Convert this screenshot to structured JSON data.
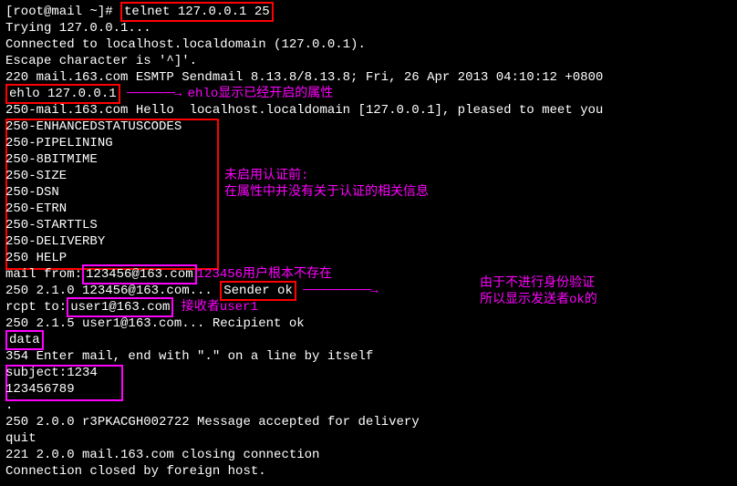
{
  "terminal": {
    "prompt": "[root@mail ~]# ",
    "cmd_telnet": "telnet 127.0.0.1 25",
    "l_trying": "Trying 127.0.0.1...",
    "l_connected": "Connected to localhost.localdomain (127.0.0.1).",
    "l_escape": "Escape character is '^]'.",
    "l_220": "220 mail.163.com ESMTP Sendmail 8.13.8/8.13.8; Fri, 26 Apr 2013 04:10:12 +0800",
    "cmd_ehlo": "ehlo 127.0.0.1",
    "ann_ehlo": "ehlo显示已经开启的属性",
    "l_250hello": "250-mail.163.com Hello  localhost.localdomain [127.0.0.1], pleased to meet you",
    "caps": [
      "250-ENHANCEDSTATUSCODES",
      "250-PIPELINING",
      "250-8BITMIME",
      "250-SIZE",
      "250-DSN",
      "250-ETRN",
      "250-STARTTLS",
      "250-DELIVERBY",
      "250 HELP"
    ],
    "ann_noauth1": "未启用认证前:",
    "ann_noauth2": "在属性中并没有关于认证的相关信息",
    "mailfrom_pre": "mail from:",
    "mailfrom_addr": "123456@163.com",
    "ann_nouser": "123456用户根本不存在",
    "l_senderok_pre": "250 2.1.0 123456@163.com... ",
    "l_senderok_box": "Sender ok",
    "ann_whyok1": "由于不进行身份验证",
    "ann_whyok2": "所以显示发送者ok的",
    "rcpt_pre": "rcpt to:",
    "rcpt_addr": "user1@163.com",
    "ann_recipient": "接收者user1",
    "l_rcptok": "250 2.1.5 user1@163.com... Recipient ok",
    "cmd_data": "data",
    "l_354": "354 Enter mail, end with \".\" on a line by itself",
    "body_subject": "subject:1234",
    "body_line2": "123456789",
    "dot": ".",
    "l_accepted": "250 2.0.0 r3PKACGH002722 Message accepted for delivery",
    "cmd_quit": "quit",
    "l_221": "221 2.0.0 mail.163.com closing connection",
    "l_closed": "Connection closed by foreign host."
  }
}
